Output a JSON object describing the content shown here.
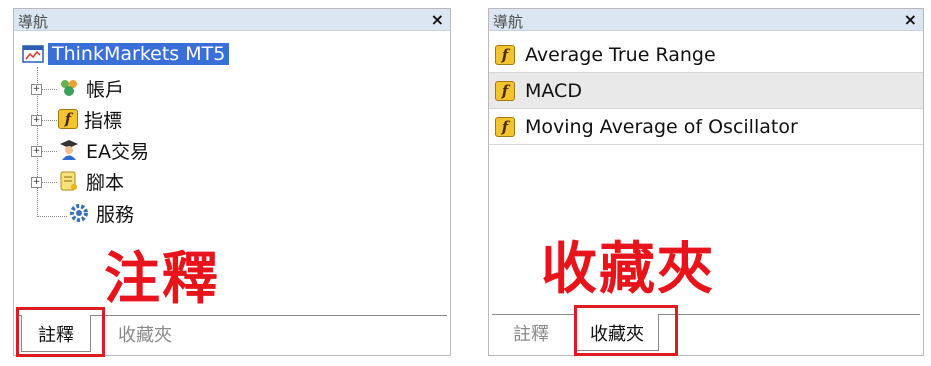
{
  "left_panel": {
    "title": "導航",
    "close": "×",
    "tree": [
      {
        "label": "ThinkMarkets MT5",
        "icon": "terminal-icon"
      },
      {
        "label": "帳戶",
        "icon": "accounts-icon"
      },
      {
        "label": "指標",
        "icon": "function-icon"
      },
      {
        "label": "EA交易",
        "icon": "expert-advisor-icon"
      },
      {
        "label": "腳本",
        "icon": "script-icon"
      },
      {
        "label": "服務",
        "icon": "gear-icon"
      }
    ],
    "overlay": "注釋",
    "tabs": [
      "註釋",
      "收藏夾"
    ],
    "active_tab": 0
  },
  "right_panel": {
    "title": "導航",
    "close": "×",
    "favorites": [
      {
        "label": "Average True Range",
        "icon": "function-icon"
      },
      {
        "label": "MACD",
        "icon": "function-icon"
      },
      {
        "label": "Moving Average of Oscillator",
        "icon": "function-icon"
      }
    ],
    "overlay": "收藏夾",
    "tabs": [
      "註釋",
      "收藏夾"
    ],
    "active_tab": 1
  },
  "colors": {
    "highlight": "#e8141c",
    "titlebar": "#dce6f2",
    "selection": "#3a6fd8"
  }
}
